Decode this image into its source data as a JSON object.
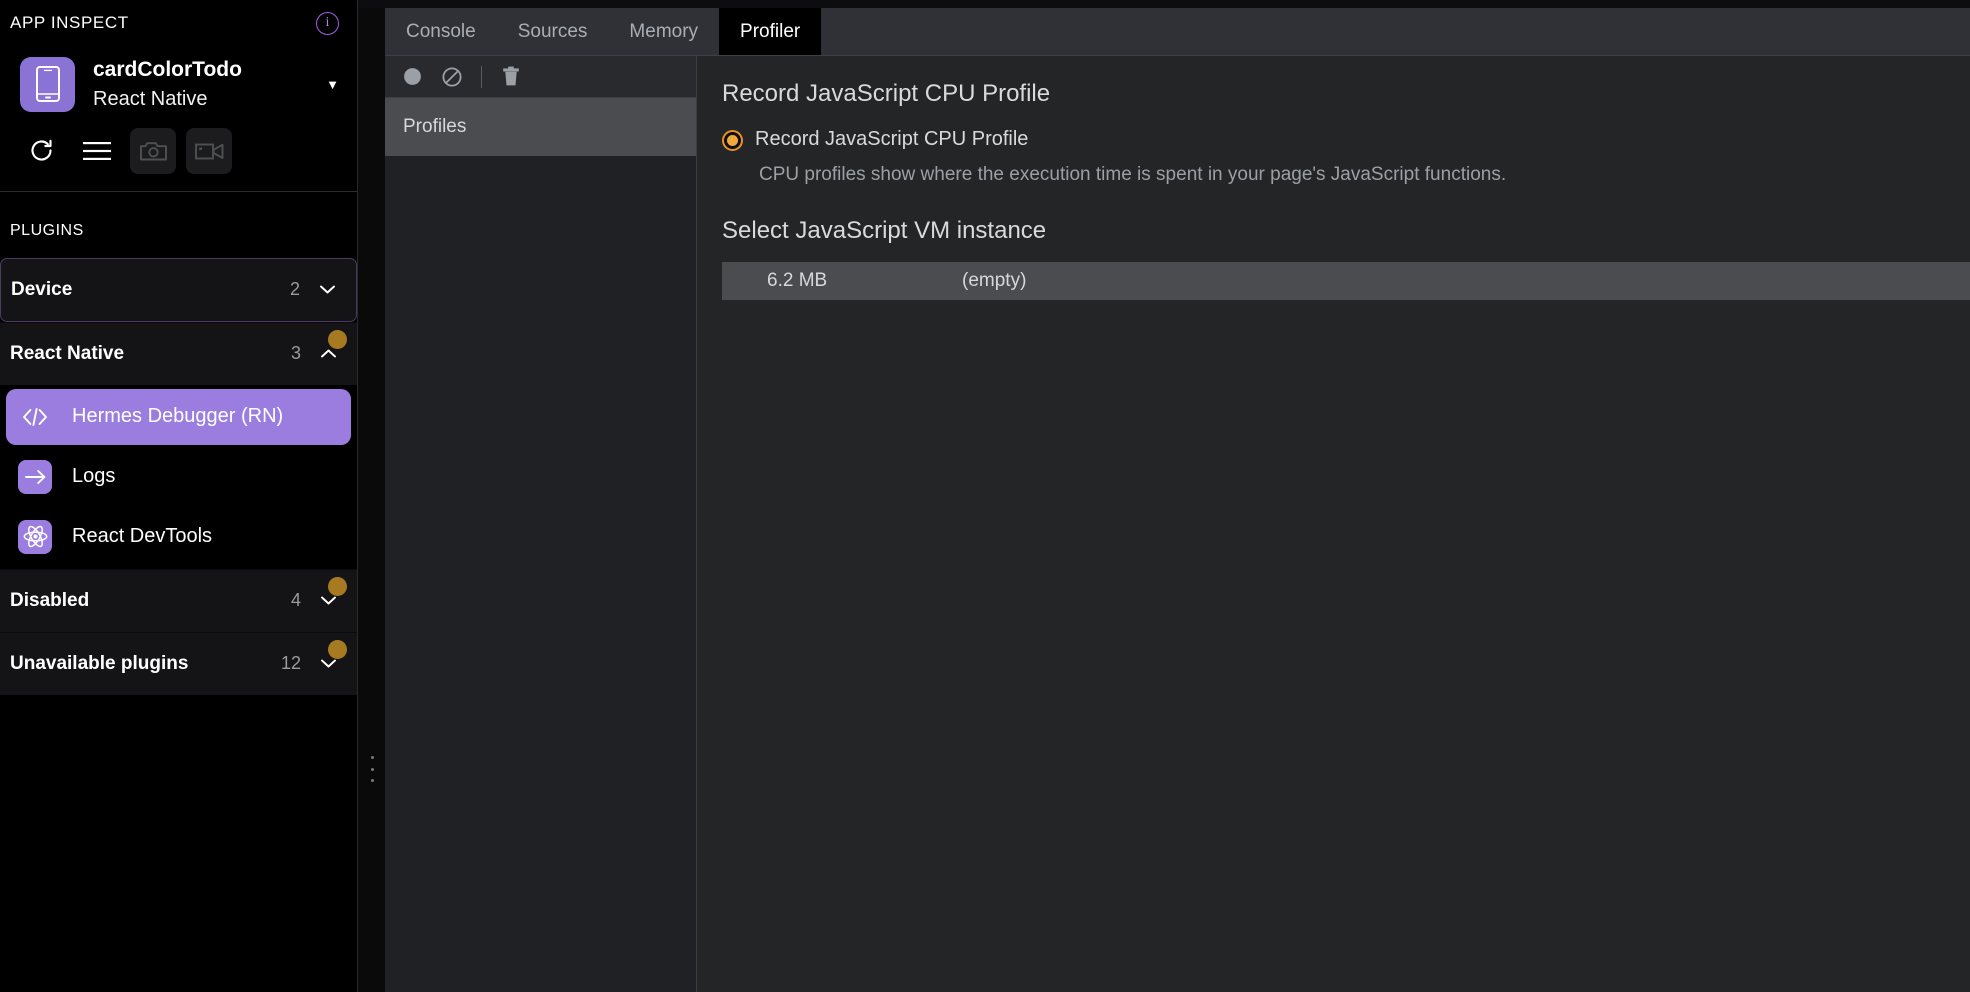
{
  "sidebar": {
    "title": "APP INSPECT",
    "info_icon": "info-icon",
    "app": {
      "name": "cardColorTodo",
      "platform": "React Native",
      "icon": "mobile-phone-icon",
      "caret": "▼"
    },
    "tools": [
      {
        "name": "reload-button",
        "icon": "reload-icon"
      },
      {
        "name": "menu-button",
        "icon": "hamburger-menu-icon"
      },
      {
        "name": "screenshot-button",
        "icon": "camera-icon"
      },
      {
        "name": "screenrecord-button",
        "icon": "video-camera-icon"
      }
    ],
    "plugins_label": "PLUGINS",
    "groups": [
      {
        "label": "Device",
        "count": "2",
        "chevron": "⌄",
        "expanded": false,
        "selected": true,
        "dot": false
      },
      {
        "label": "React Native",
        "count": "3",
        "chevron": "⌃",
        "expanded": true,
        "selected": false,
        "dot": true
      },
      {
        "label": "Disabled",
        "count": "4",
        "chevron": "⌄",
        "expanded": false,
        "selected": false,
        "dot": true
      },
      {
        "label": "Unavailable plugins",
        "count": "12",
        "chevron": "⌄",
        "expanded": false,
        "selected": false,
        "dot": true
      }
    ],
    "plugins": [
      {
        "label": "Hermes Debugger (RN)",
        "icon": "code-brackets-icon",
        "active": true
      },
      {
        "label": "Logs",
        "icon": "arrow-right-icon",
        "active": false
      },
      {
        "label": "React DevTools",
        "icon": "react-atom-icon",
        "active": false
      }
    ]
  },
  "devtools": {
    "tabs": [
      {
        "label": "Console",
        "active": false
      },
      {
        "label": "Sources",
        "active": false
      },
      {
        "label": "Memory",
        "active": false
      },
      {
        "label": "Profiler",
        "active": true
      }
    ],
    "profiles_pane": {
      "toolbar": [
        {
          "name": "record-button",
          "icon": "record-circle-icon"
        },
        {
          "name": "clear-all-button",
          "icon": "no-entry-icon"
        },
        {
          "name": "delete-button",
          "icon": "trash-icon"
        }
      ],
      "section_label": "Profiles"
    },
    "main": {
      "heading_record": "Record JavaScript CPU Profile",
      "radio_label": "Record JavaScript CPU Profile",
      "radio_selected": true,
      "radio_description": "CPU profiles show where the execution time is spent in your page's JavaScript functions.",
      "heading_vm": "Select JavaScript VM instance",
      "vm_rows": [
        {
          "size": "6.2 MB",
          "name": "(empty)",
          "selected": true
        }
      ]
    }
  },
  "colors": {
    "accent_purple": "#9b7de0",
    "badge_amber": "#a77a22",
    "radio_orange": "#f0a93e",
    "sidebar_bg": "#000000",
    "panel_bg": "#242527",
    "tabbar_bg": "#2f3136"
  }
}
